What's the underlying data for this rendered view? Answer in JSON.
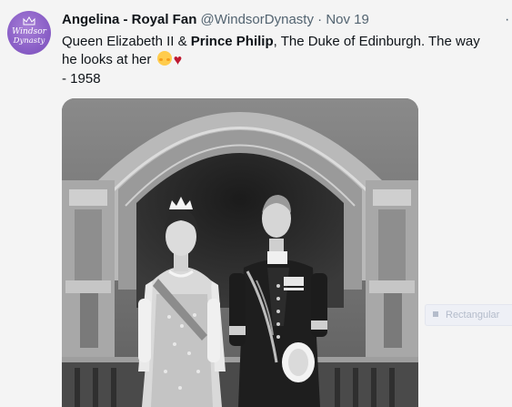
{
  "tweet": {
    "avatar": {
      "line1": "Windsor",
      "line2": "Dynasty",
      "icon": "crown-icon",
      "color": "#8a5fc7"
    },
    "display_name": "Angelina - Royal Fan",
    "handle": "@WindsorDynasty",
    "separator": "·",
    "timestamp": "Nov 19",
    "more_icon": "more-icon",
    "text": {
      "part1": "Queen Elizabeth II & ",
      "bold": "Prince Philip",
      "part2": ", The Duke of Edinburgh. The way he looks at her ",
      "emoji1": "smiling-face-with-blush-icon",
      "emoji2": "red-heart-icon",
      "year": "- 1958"
    },
    "photo": {
      "subject": "photo"
    }
  },
  "overlay": {
    "label": "Rectangular"
  }
}
